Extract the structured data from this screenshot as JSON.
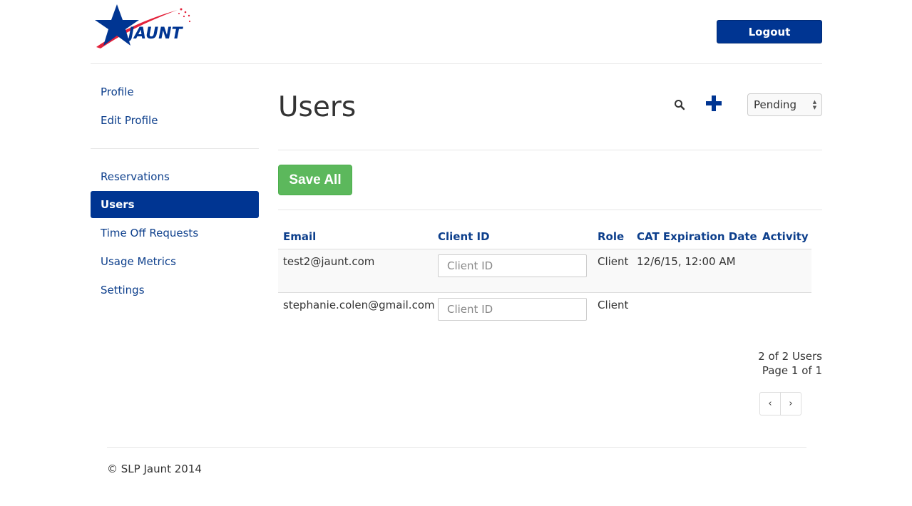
{
  "header": {
    "logo_text": "JAUNT",
    "logout_label": "Logout"
  },
  "sidebar": {
    "group1": [
      {
        "label": "Profile"
      },
      {
        "label": "Edit Profile"
      }
    ],
    "group2": [
      {
        "label": "Reservations",
        "active": false
      },
      {
        "label": "Users",
        "active": true
      },
      {
        "label": "Time Off Requests",
        "active": false
      },
      {
        "label": "Usage Metrics",
        "active": false
      },
      {
        "label": "Settings",
        "active": false
      }
    ]
  },
  "main": {
    "title": "Users",
    "status_filter": "Pending",
    "save_all_label": "Save All",
    "table": {
      "columns": [
        "Email",
        "Client ID",
        "Role",
        "CAT Expiration Date",
        "Activity"
      ],
      "rows": [
        {
          "email": "test2@jaunt.com",
          "client_id_placeholder": "Client ID",
          "role": "Client",
          "cat_expiration": "12/6/15, 12:00 AM",
          "activity": ""
        },
        {
          "email": "stephanie.colen@gmail.com",
          "client_id_placeholder": "Client ID",
          "role": "Client",
          "cat_expiration": "",
          "activity": ""
        }
      ]
    },
    "pagination": {
      "count_text": "2 of 2 Users",
      "page_text": "Page 1 of 1",
      "prev": "‹",
      "next": "›"
    }
  },
  "footer": {
    "copyright": "© SLP Jaunt 2014"
  },
  "colors": {
    "brand_blue": "#003592",
    "link_blue": "#0d3f8c",
    "logo_red": "#e3213a",
    "success_green": "#5cb85c"
  }
}
